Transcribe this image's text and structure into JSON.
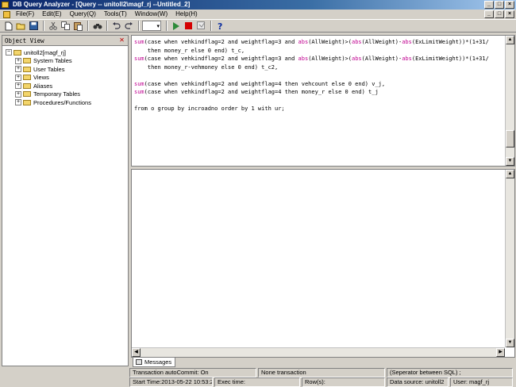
{
  "window": {
    "title": "DB Query Analyzer - [Query -- unitoll2\\magf_rj --Untitled_2]",
    "controls": [
      "_",
      "□",
      "×"
    ]
  },
  "menubar": {
    "items": [
      "File(F)",
      "Edit(E)",
      "Query(Q)",
      "Tools(T)",
      "Window(W)",
      "Help(H)"
    ],
    "mdi_controls": [
      "_",
      "□",
      "×"
    ]
  },
  "toolbar": {
    "icons": [
      "new-file-icon",
      "open-folder-icon",
      "save-icon",
      "cut-icon",
      "copy-icon",
      "paste-icon",
      "find-icon",
      "undo-icon",
      "redo-icon",
      "grid-combo",
      "execute-icon",
      "stop-icon",
      "parse-icon",
      "help-icon"
    ],
    "colors": {
      "execute": "#2e8b3a",
      "stop": "#d40000"
    }
  },
  "object_view": {
    "title": "Object View",
    "root": "unitoll2[magf_rj]",
    "children": [
      "System Tables",
      "User Tables",
      "Views",
      "Aliases",
      "Temporary Tables",
      "Procedures/Functions"
    ]
  },
  "editor": {
    "lines": [
      [
        [
          "fn",
          "sum"
        ],
        [
          "t",
          "(case when vehkindflag=2 and weightflag=3 and "
        ],
        [
          "fn",
          "abs"
        ],
        [
          "t",
          "(AllWeight)>("
        ],
        [
          "fn",
          "abs"
        ],
        [
          "t",
          "(AllWeight)-"
        ],
        [
          "fn",
          "abs"
        ],
        [
          "t",
          "(ExLimitWeight))*(1+31/"
        ]
      ],
      [
        [
          "t",
          "    then money_r else 0 end) t_c,"
        ]
      ],
      [
        [
          "fn",
          "sum"
        ],
        [
          "t",
          "(case when vehkindflag=2 and weightflag=3 and "
        ],
        [
          "fn",
          "abs"
        ],
        [
          "t",
          "(AllWeight)>("
        ],
        [
          "fn",
          "abs"
        ],
        [
          "t",
          "(AllWeight)-"
        ],
        [
          "fn",
          "abs"
        ],
        [
          "t",
          "(ExLimitWeight))*(1+31/"
        ]
      ],
      [
        [
          "t",
          "    then money_r-vehmoney else 0 end) t_c2,"
        ]
      ],
      [
        [
          "t",
          ""
        ]
      ],
      [
        [
          "fn",
          "sum"
        ],
        [
          "t",
          "(case when vehkindflag=2 and weightflag=4 then vehcount else 0 end) v_j,"
        ]
      ],
      [
        [
          "fn",
          "sum"
        ],
        [
          "t",
          "(case when vehkindflag=2 and weightflag=4 then money_r else 0 end) t_j"
        ]
      ],
      [
        [
          "t",
          ""
        ]
      ],
      [
        [
          "t",
          "from o group by incroadno order by 1 with ur;"
        ]
      ]
    ],
    "colors": {
      "function": "#c00090",
      "text": "#000000"
    }
  },
  "tabs": {
    "messages": "Messages"
  },
  "status": {
    "transaction": "Transaction autoCommit: On",
    "none_transaction": "None transaction",
    "separator": "(Seperator between SQL)  ;",
    "start_time": "Start Time:2013-05-22 10:53:23",
    "exec_time": "Exec time:",
    "rows": "Row(s):",
    "datasource": "Data source: unitoll2",
    "user": "User: magf_rj"
  }
}
